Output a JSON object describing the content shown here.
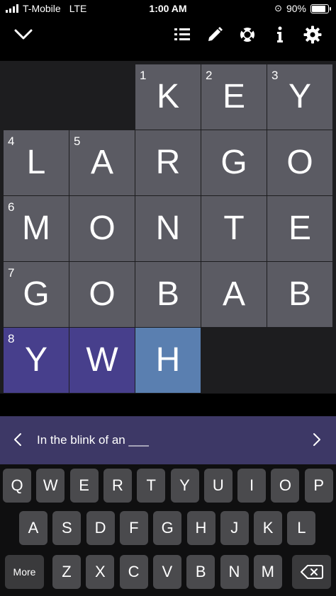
{
  "status_bar": {
    "carrier": "T-Mobile",
    "network": "LTE",
    "time": "1:00 AM",
    "battery": "90%"
  },
  "toolbar": {
    "icons": [
      "chevron-down-icon",
      "list-icon",
      "pencil-icon",
      "lifebuoy-icon",
      "info-icon",
      "gear-icon"
    ]
  },
  "grid": {
    "rows": [
      [
        null,
        null,
        {
          "num": "1",
          "letter": "K"
        },
        {
          "num": "2",
          "letter": "E"
        },
        {
          "num": "3",
          "letter": "Y"
        }
      ],
      [
        {
          "num": "4",
          "letter": "L"
        },
        {
          "num": "5",
          "letter": "A"
        },
        {
          "letter": "R"
        },
        {
          "letter": "G"
        },
        {
          "letter": "O"
        }
      ],
      [
        {
          "num": "6",
          "letter": "M"
        },
        {
          "letter": "O"
        },
        {
          "letter": "N"
        },
        {
          "letter": "T"
        },
        {
          "letter": "E"
        }
      ],
      [
        {
          "num": "7",
          "letter": "G"
        },
        {
          "letter": "O"
        },
        {
          "letter": "B"
        },
        {
          "letter": "A"
        },
        {
          "letter": "B"
        }
      ],
      [
        {
          "num": "8",
          "letter": "Y",
          "state": "highlight"
        },
        {
          "letter": "W",
          "state": "highlight"
        },
        {
          "letter": "H",
          "state": "selected"
        },
        null,
        null
      ]
    ]
  },
  "clue": {
    "text": "In the blink of an ___"
  },
  "keyboard": {
    "row1": [
      "Q",
      "W",
      "E",
      "R",
      "T",
      "Y",
      "U",
      "I",
      "O",
      "P"
    ],
    "row2": [
      "A",
      "S",
      "D",
      "F",
      "G",
      "H",
      "J",
      "K",
      "L"
    ],
    "row3": [
      "Z",
      "X",
      "C",
      "V",
      "B",
      "N",
      "M"
    ],
    "more_label": "More"
  },
  "colors": {
    "cell": "#5b5b63",
    "highlight": "#473f8c",
    "selected": "#5a7fb0",
    "clue_bar": "#3d3866"
  }
}
